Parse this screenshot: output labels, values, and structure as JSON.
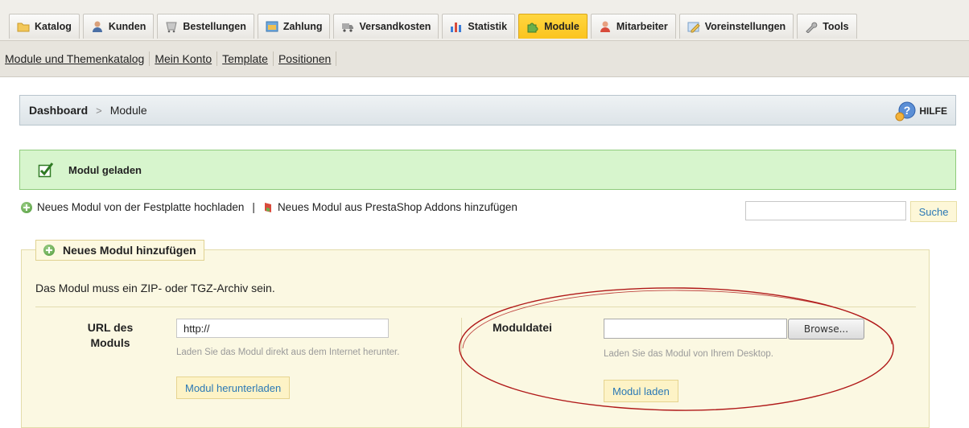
{
  "tabs": [
    {
      "label": "Katalog",
      "icon": "folder-icon"
    },
    {
      "label": "Kunden",
      "icon": "customer-icon"
    },
    {
      "label": "Bestellungen",
      "icon": "orders-icon"
    },
    {
      "label": "Zahlung",
      "icon": "payment-icon"
    },
    {
      "label": "Versandkosten",
      "icon": "truck-icon"
    },
    {
      "label": "Statistik",
      "icon": "bar-chart-icon"
    },
    {
      "label": "Module",
      "icon": "puzzle-icon",
      "active": true
    },
    {
      "label": "Mitarbeiter",
      "icon": "employee-icon"
    },
    {
      "label": "Voreinstellungen",
      "icon": "preferences-icon"
    },
    {
      "label": "Tools",
      "icon": "wrench-icon"
    }
  ],
  "submenu": [
    "Module und Themenkatalog",
    "Mein Konto",
    "Template",
    "Positionen"
  ],
  "breadcrumb": {
    "home": "Dashboard",
    "separator": ">",
    "current": "Module",
    "help": "HILFE"
  },
  "success": {
    "text": "Modul geladen"
  },
  "links": {
    "upload": "Neues Modul von der Festplatte hochladen",
    "divider": "|",
    "addons": "Neues Modul aus PrestaShop Addons hinzufügen"
  },
  "search": {
    "value": "",
    "button": "Suche"
  },
  "add_module": {
    "legend": "Neues Modul hinzufügen",
    "description": "Das Modul muss ein ZIP- oder TGZ-Archiv sein.",
    "url_label": "URL des Moduls",
    "url_value": "http://",
    "url_hint": "Laden Sie das Modul direkt aus dem Internet herunter.",
    "url_button": "Modul herunterladen",
    "file_label": "Moduldatei",
    "browse_button": "Browse...",
    "file_hint": "Laden Sie das Modul von Ihrem Desktop.",
    "file_button": "Modul laden"
  },
  "colors": {
    "active_tab": "#fbc41e",
    "success_bg": "#d7f5cd",
    "link_blue": "#2a78b5",
    "annotation_red": "#b01818"
  }
}
